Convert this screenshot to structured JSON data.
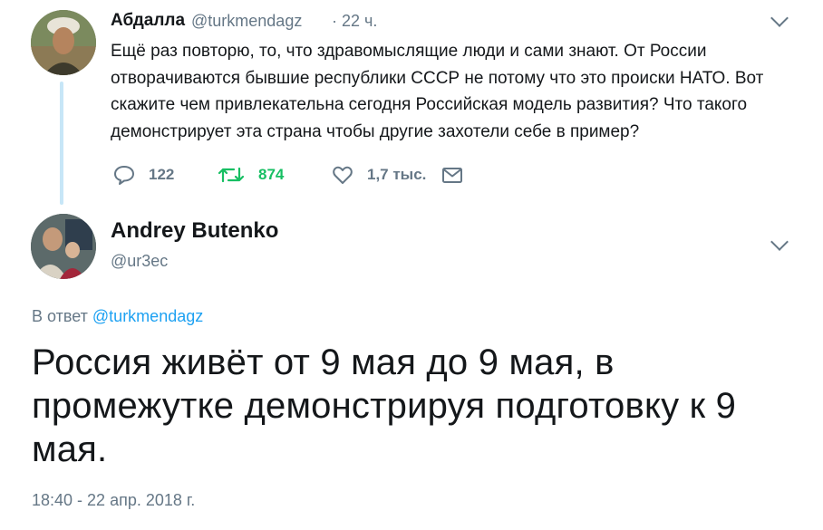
{
  "parent_tweet": {
    "author_name": "Абдалла",
    "author_handle": "@turkmendagz",
    "separator": "·",
    "time": "22 ч.",
    "text": "Ещё раз повторю, то, что здравомыслящие люди и сами знают. От России отворачиваются бывшие республики СССР не потому что это происки НАТО. Вот скажите чем привлекательна сегодня Российская модель развития? Что такого демонстрирует эта страна чтобы другие захотели себе в пример?",
    "actions": {
      "replies": "122",
      "retweets": "874",
      "likes": "1,7 тыс."
    }
  },
  "main_tweet": {
    "author_name": "Andrey Butenko",
    "author_handle": "@ur3ec",
    "reply_prefix": "В ответ",
    "reply_to": "@turkmendagz",
    "text": "Россия живёт от 9 мая до 9 мая, в промежутке демонстрируя подготовку к 9 мая.",
    "timestamp": "18:40 - 22 апр. 2018 г."
  },
  "colors": {
    "text": "#14171a",
    "secondary": "#657786",
    "link": "#1da1f2",
    "retweet_green": "#17bf63",
    "thread_line": "#c7e6f7"
  },
  "icons": {
    "reply": "reply-icon",
    "retweet": "retweet-icon",
    "like": "heart-icon",
    "dm": "envelope-icon",
    "menu": "chevron-down-icon"
  }
}
